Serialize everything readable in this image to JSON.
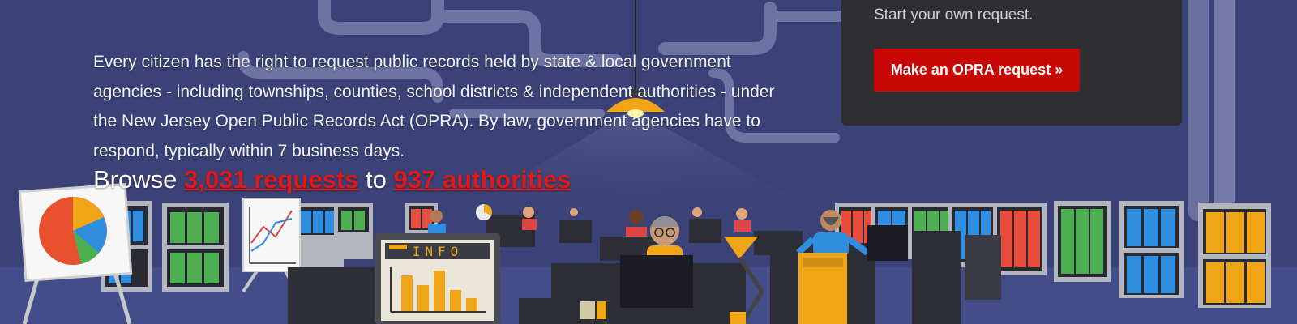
{
  "hero": {
    "headline_fragment": "",
    "intro": "Every citizen has the right to request public records held by state & local government agencies - including townships, counties, school districts & independent authorities - under the New Jersey Open Public Records Act (OPRA). By law, government agencies have to respond, typically within 7 business days.",
    "browse_prefix": "Browse ",
    "requests_link": "3,031 requests",
    "browse_middle": " to ",
    "authorities_link": "937 authorities"
  },
  "cta": {
    "subtitle": "Start your own request.",
    "button_label": "Make an OPRA request »"
  },
  "illustration": {
    "info_sign": "INFO"
  },
  "colors": {
    "background": "#3a4278",
    "panel": "#2f2f33",
    "accent_red": "#c70606",
    "link_red": "#e01818"
  }
}
